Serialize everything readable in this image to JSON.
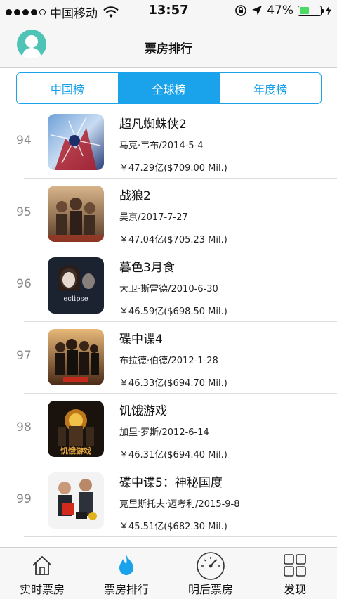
{
  "status_bar": {
    "carrier": "中国移动",
    "time": "13:57",
    "battery_percent": "47%"
  },
  "nav": {
    "title": "票房排行"
  },
  "segments": [
    {
      "label": "中国榜",
      "active": false
    },
    {
      "label": "全球榜",
      "active": true
    },
    {
      "label": "年度榜",
      "active": false
    }
  ],
  "movies": [
    {
      "rank": "94",
      "title": "超凡蜘蛛侠2",
      "meta": "马克·韦布/2014-5-4",
      "gross": "￥47.29亿($709.00 Mil.)"
    },
    {
      "rank": "95",
      "title": "战狼2",
      "meta": "吴京/2017-7-27",
      "gross": "￥47.04亿($705.23 Mil.)"
    },
    {
      "rank": "96",
      "title": "暮色3月食",
      "meta": "大卫·斯雷德/2010-6-30",
      "gross": "￥46.59亿($698.50 Mil.)"
    },
    {
      "rank": "97",
      "title": "碟中谍4",
      "meta": "布拉德·伯德/2012-1-28",
      "gross": "￥46.33亿($694.70 Mil.)"
    },
    {
      "rank": "98",
      "title": "饥饿游戏",
      "meta": "加里·罗斯/2012-6-14",
      "gross": "￥46.31亿($694.40 Mil.)"
    },
    {
      "rank": "99",
      "title": "碟中谍5：神秘国度",
      "meta": "克里斯托夫·迈考利/2015-9-8",
      "gross": "￥45.51亿($682.30 Mil.)"
    }
  ],
  "poster_texts": {
    "p96": "eclipse",
    "p98": "饥饿游戏"
  },
  "colors": {
    "accent": "#1aa3ea",
    "avatar": "#4fc3b5",
    "battery": "#4cd964"
  },
  "tabs": [
    {
      "label": "实时票房",
      "icon": "house-icon",
      "active": false
    },
    {
      "label": "票房排行",
      "icon": "flame-icon",
      "active": true
    },
    {
      "label": "明后票房",
      "icon": "speedometer-icon",
      "active": false
    },
    {
      "label": "发现",
      "icon": "grid-icon",
      "active": false
    }
  ]
}
